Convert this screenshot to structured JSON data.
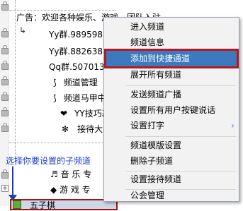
{
  "channel_tree": {
    "rows": [
      {
        "text": "广告：欢迎各种娱乐、游戏、团队入驻"
      },
      {
        "text": "Yy群.9895983."
      },
      {
        "text": "Yy群.8826386."
      },
      {
        "text": "Qq群.50701333"
      },
      {
        "text": "频道管理"
      },
      {
        "text": "频道马甲中"
      },
      {
        "text": "YY技巧基"
      },
      {
        "text": "接待大"
      }
    ],
    "sub_rows": [
      {
        "text": "♬  音  乐  专"
      },
      {
        "text": "◆  游  戏  专"
      },
      {
        "text": "五子棋"
      }
    ],
    "hint": "选择你要设置的子频道"
  },
  "context_menu": {
    "items": [
      {
        "label": "进入频道"
      },
      {
        "label": "频道信息"
      },
      {
        "label": "添加到快捷通道"
      },
      {
        "label": "展开所有频道"
      },
      {
        "label": "发送频道广播"
      },
      {
        "label": "设置所有用户按键说话"
      },
      {
        "label": "设置打字"
      },
      {
        "label": "频道模版设置"
      },
      {
        "label": "删除子频道"
      },
      {
        "label": "设置接待频道"
      },
      {
        "label": "公会管理"
      }
    ],
    "selected_index": 2,
    "highlight_color": "#3c79bf",
    "selection_outline_color": "#b3191f"
  }
}
